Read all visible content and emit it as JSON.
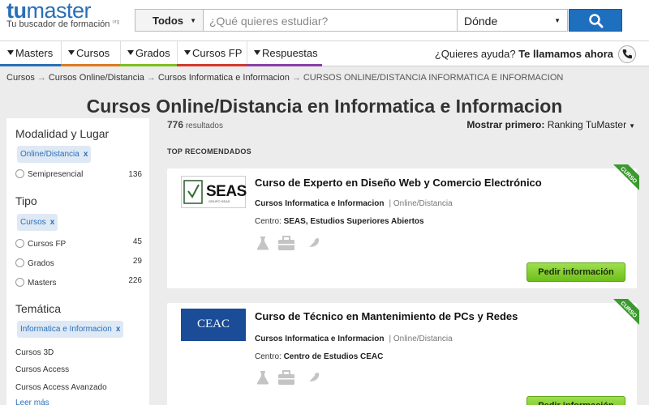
{
  "brand": {
    "name_a": "tu",
    "name_b": "master",
    "tagline": "Tu buscador de formación",
    "tagline_sup": "org"
  },
  "search": {
    "category": "Todos",
    "placeholder": "¿Qué quieres estudiar?",
    "where": "Dónde",
    "button_icon": "search-icon"
  },
  "nav": {
    "items": [
      {
        "label": "Masters",
        "color": "#2a6fb6"
      },
      {
        "label": "Cursos",
        "color": "#e07a1f"
      },
      {
        "label": "Grados",
        "color": "#7cbf1f"
      },
      {
        "label": "Cursos FP",
        "color": "#d23a2e"
      },
      {
        "label": "Respuestas",
        "color": "#8a3fa7"
      }
    ],
    "help_text": "¿Quieres ayuda?",
    "help_cta": "Te llamamos ahora",
    "phone_icon": "phone-icon"
  },
  "breadcrumb": {
    "items": [
      "Cursos",
      "Cursos Online/Distancia",
      "Cursos Informatica e Informacion"
    ],
    "current": "CURSOS ONLINE/DISTANCIA INFORMATICA E INFORMACION",
    "separator": "→"
  },
  "page_title": "Cursos Online/Distancia en Informatica e Informacion",
  "results": {
    "count": "776",
    "label": "resultados"
  },
  "sort": {
    "label": "Mostrar primero:",
    "value": "Ranking TuMaster"
  },
  "section_label": "TOP RECOMENDADOS",
  "sidebar": {
    "modalidad": {
      "heading": "Modalidad y Lugar",
      "selected": "Online/Distancia",
      "options": [
        {
          "label": "Semipresencial",
          "count": "136"
        }
      ]
    },
    "tipo": {
      "heading": "Tipo",
      "selected": "Cursos",
      "options": [
        {
          "label": "Cursos FP",
          "count": "45"
        },
        {
          "label": "Grados",
          "count": "29"
        },
        {
          "label": "Masters",
          "count": "226"
        }
      ]
    },
    "tematica": {
      "heading": "Temática",
      "selected": "Informatica e Informacion",
      "links": [
        "Cursos 3D",
        "Cursos Access",
        "Cursos Access Avanzado"
      ],
      "more": "Leer más"
    },
    "remove_label": "x"
  },
  "cards": [
    {
      "title": "Curso de Experto en Diseño Web y Comercio Electrónico",
      "category": "Cursos Informatica e Informacion",
      "mode": "| Online/Distancia",
      "centro_label": "Centro:",
      "centro": "SEAS, Estudios Superiores Abiertos",
      "logo_text": "SEAS",
      "logo_sub": "GRUPO SEAS",
      "button": "Pedir información",
      "ribbon": "CURSO"
    },
    {
      "title": "Curso de Técnico en Mantenimiento de PCs y Redes",
      "category": "Cursos Informatica e Informacion",
      "mode": "| Online/Distancia",
      "centro_label": "Centro:",
      "centro": "Centro de Estudios CEAC",
      "logo_text": "CEAC",
      "button": "Pedir información",
      "ribbon": "CURSO"
    }
  ]
}
